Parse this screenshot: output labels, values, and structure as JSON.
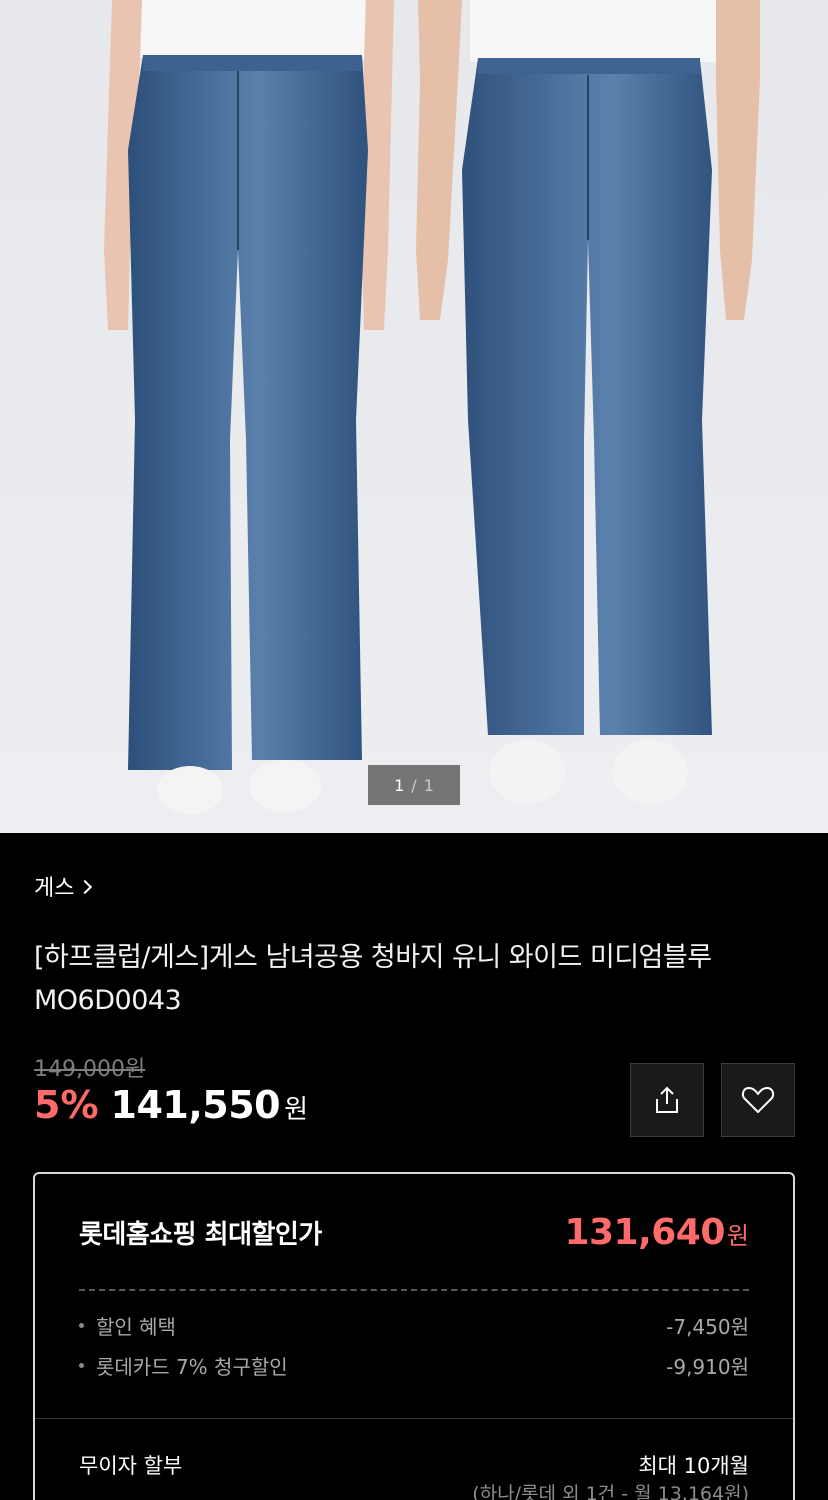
{
  "gallery": {
    "current": "1",
    "separator": "/",
    "total": "1"
  },
  "brand": {
    "name": "게스"
  },
  "product": {
    "title": "[하프클럽/게스]게스 남녀공용 청바지 유니 와이드 미디엄블루 MO6D0043",
    "original_price": "149,000원",
    "discount_rate": "5%",
    "sale_price": "141,550",
    "currency": "원"
  },
  "actions": {
    "share_icon": "share-icon",
    "wish_icon": "heart-icon"
  },
  "max_discount": {
    "heading": "롯데홈쇼핑 최대할인가",
    "price": "131,640",
    "unit": "원",
    "items": [
      {
        "label": "할인 혜택",
        "value": "-7,450원"
      },
      {
        "label": "롯데카드 7% 청구할인",
        "value": "-9,910원"
      }
    ],
    "installment": {
      "label": "무이자 할부",
      "value": "최대 10개월",
      "detail": "(하나/롯데 외 1건 - 월 13,164원)"
    }
  },
  "colors": {
    "accent": "#ff6b6b",
    "background": "#000000",
    "border": "#d9d9d9"
  }
}
